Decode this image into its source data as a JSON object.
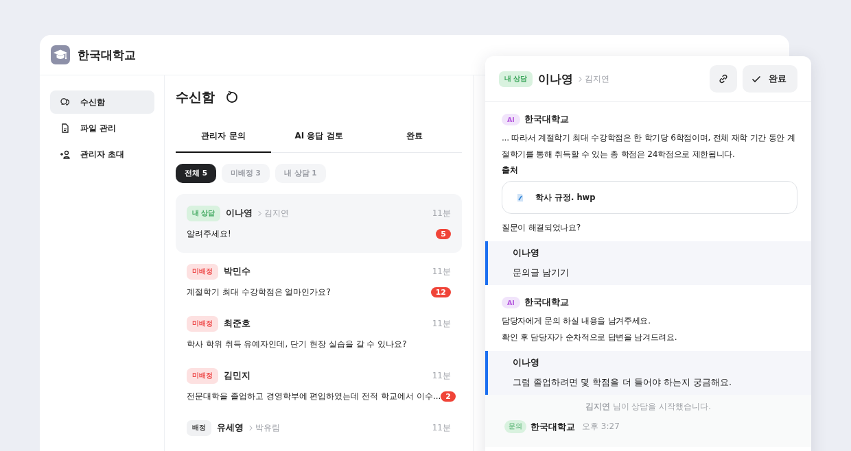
{
  "brand": {
    "name": "한국대학교"
  },
  "sidebar": {
    "items": [
      {
        "kind": "inbox",
        "label": "수신함",
        "selected": true
      },
      {
        "kind": "files",
        "label": "파일 관리",
        "selected": false
      },
      {
        "kind": "invite",
        "label": "관리자 초대",
        "selected": false
      }
    ]
  },
  "inbox": {
    "title": "수신함",
    "tabs": [
      {
        "label": "관리자 문의",
        "selected": true
      },
      {
        "label": "AI 응답 검토",
        "selected": false
      },
      {
        "label": "완료",
        "selected": false
      }
    ],
    "filters": [
      {
        "label": "전체 5",
        "selected": true
      },
      {
        "label": "미배정 3",
        "selected": false
      },
      {
        "label": "내 상담 1",
        "selected": false
      }
    ],
    "conversations": [
      {
        "kind": "mine",
        "tag": "내 상담",
        "name": "이나영",
        "assignee": "김지연",
        "time": "11분",
        "preview": "알려주세요!",
        "unread": "5",
        "selected": true
      },
      {
        "kind": "unassigned",
        "tag": "미배정",
        "name": "박민수",
        "time": "11분",
        "preview": "계절학기 최대 수강학점은 얼마인가요?",
        "unread": "12",
        "selected": false
      },
      {
        "kind": "unassigned",
        "tag": "미배정",
        "name": "최준호",
        "time": "11분",
        "preview": "학사 학위 취득 유예자인데, 단기 현장 실습을 갈 수 있나요?",
        "selected": false
      },
      {
        "kind": "unassigned",
        "tag": "미배정",
        "name": "김민지",
        "time": "11분",
        "preview": "전문대학을 졸업하고 경영학부에 편입하였는데 전적 학교에서 이수...",
        "unread": "2",
        "selected": false
      },
      {
        "kind": "assigned",
        "tag": "배정",
        "name": "유세영",
        "assignee": "박유림",
        "time": "11분",
        "selected": false
      }
    ]
  },
  "panel": {
    "kind": "mine",
    "tag": "내 상담",
    "name": "이나영",
    "assignee": "김지연",
    "done_button": "완료",
    "messages": [
      {
        "kind": "ai",
        "badge": "AI",
        "sender": "한국대학교",
        "lines": [
          "... 따라서 계절학기 최대 수강학점은 한 학기당 6학점이며, 전체 재학 기간 동안 계절학기를 통해 취득할 수 있는 총 학점은 24학점으로 제한됩니다."
        ],
        "source_label": "출처",
        "source_file": "학사 규정. hwp",
        "followup": "질문이 해결되었나요?"
      },
      {
        "kind": "user",
        "sender": "이나영",
        "lines": [
          "문의글 남기기"
        ]
      },
      {
        "kind": "ai",
        "badge": "AI",
        "sender": "한국대학교",
        "lines": [
          "담당자에게 문의 하실 내용을 남겨주세요.",
          "확인 후 담당자가 순차적으로 답변을 남겨드려요."
        ]
      },
      {
        "kind": "user",
        "sender": "이나영",
        "lines": [
          "그럼 졸업하려면 몇 학점을 더 들어야 하는지 궁금해요."
        ]
      },
      {
        "kind": "system",
        "text": "**김지연** 님이 상담을 시작했습니다."
      },
      {
        "kind": "inquiry",
        "badge": "문의",
        "sender": "한국대학교",
        "time": "오후 3:27"
      }
    ]
  }
}
